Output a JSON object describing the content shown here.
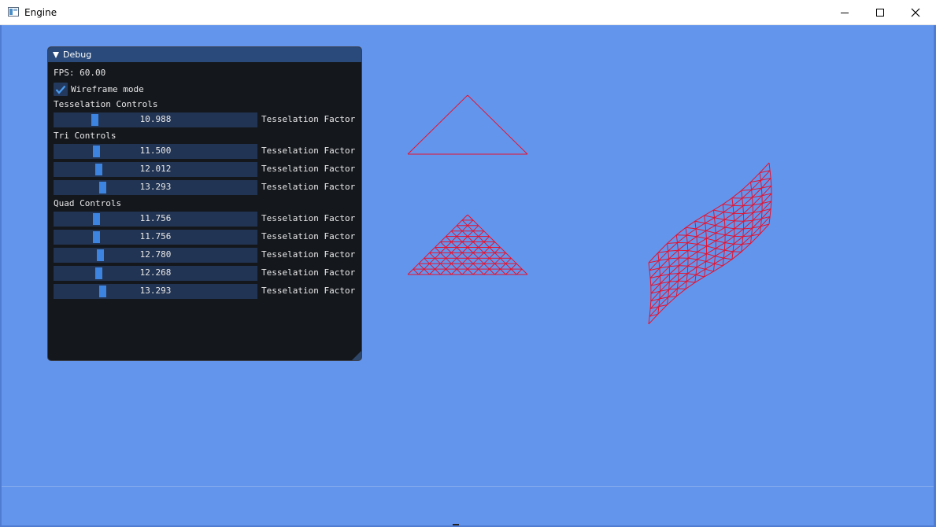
{
  "window": {
    "title": "Engine",
    "icon": "app-window-icon",
    "controls": [
      "minimize-icon",
      "maximize-icon",
      "close-icon"
    ]
  },
  "colors": {
    "background": "#6495ed",
    "panel_bg": "#14171c",
    "panel_header": "#294a7a",
    "slider_track": "#223453",
    "slider_grab": "#3d84e0",
    "wire": "#e8112d"
  },
  "debug": {
    "title": "Debug",
    "fps": "FPS: 60.00",
    "wireframe_label": "Wireframe mode",
    "wireframe_checked": true,
    "tess_section": "Tesselation Controls",
    "tess_sliders": [
      {
        "value": "10.988",
        "label": "Tesselation Factor",
        "fraction": 0.19
      }
    ],
    "tri_section": "Tri Controls",
    "tri_sliders": [
      {
        "value": "11.500",
        "label": "Tesselation Factor",
        "fraction": 0.2
      },
      {
        "value": "12.012",
        "label": "Tesselation Factor",
        "fraction": 0.21
      },
      {
        "value": "13.293",
        "label": "Tesselation Factor",
        "fraction": 0.23
      }
    ],
    "quad_section": "Quad Controls",
    "quad_sliders": [
      {
        "value": "11.756",
        "label": "Tesselation Factor",
        "fraction": 0.2
      },
      {
        "value": "11.756",
        "label": "Tesselation Factor",
        "fraction": 0.2
      },
      {
        "value": "12.780",
        "label": "Tesselation Factor",
        "fraction": 0.22
      },
      {
        "value": "12.268",
        "label": "Tesselation Factor",
        "fraction": 0.21
      },
      {
        "value": "13.293",
        "label": "Tesselation Factor",
        "fraction": 0.23
      }
    ]
  },
  "scene": {
    "objects": [
      "triangle-outline",
      "tessellated-triangle",
      "tessellated-quad-surface"
    ]
  }
}
